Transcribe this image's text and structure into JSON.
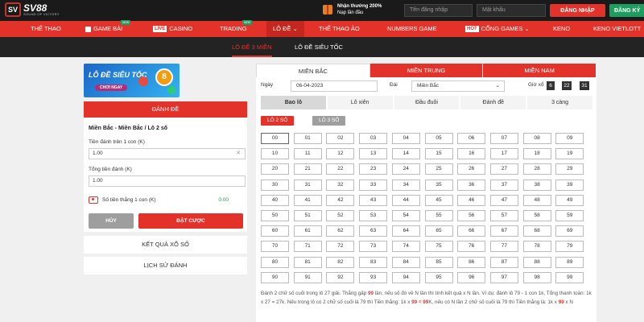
{
  "header": {
    "logo_mark": "SV",
    "logo_name": "SV88",
    "logo_sub": "SOUND OF VICTORY",
    "promo_title": "Nhận thưởng 200%",
    "promo_sub": "Nạp lần đầu",
    "username_placeholder": "Tên đăng nhập",
    "password_placeholder": "Mật khẩu",
    "login_label": "ĐĂNG NHẬP",
    "register_label": "ĐĂNG KÝ"
  },
  "nav": {
    "items": [
      {
        "label": "THỂ THAO"
      },
      {
        "label": "GAME BÀI",
        "badge": "NEW"
      },
      {
        "label": "CASINO",
        "tag": "LIVE"
      },
      {
        "label": "TRADING",
        "badge": "NEW"
      },
      {
        "label": "LÔ ĐỀ"
      },
      {
        "label": "THỂ THAO ẢO"
      },
      {
        "label": "NUMBERS GAME"
      },
      {
        "label": "CỔNG GAMES",
        "tag": "HOT"
      },
      {
        "label": "KENO"
      },
      {
        "label": "KENO VIETLOTT"
      }
    ]
  },
  "subnav": {
    "items": [
      {
        "label": "LÔ ĐỀ 3 MIỀN"
      },
      {
        "label": "LÔ ĐỀ SIÊU TỐC"
      }
    ]
  },
  "banner": {
    "title": "LÔ ĐỀ SIÊU TỐC",
    "button": "CHƠI NGAY",
    "ball_number": "8"
  },
  "bet_panel": {
    "header": "ĐÁNH ĐỀ",
    "selection": "Miền Bắc - Miền Bắc / Lô 2 số",
    "stake_label": "Tiền đánh trên 1 con (K)",
    "stake_value": "1.00",
    "total_label": "Tổng tiền đánh (K)",
    "total_value": "1.00",
    "win_label": "Số tiền thắng 1 con (K)",
    "win_value": "0.00",
    "cancel_label": "HỦY",
    "bet_label": "ĐẶT CƯỢC"
  },
  "side_links": {
    "results": "KẾT QUẢ XỔ SỐ",
    "history": "LỊCH SỬ ĐÁNH"
  },
  "region_tabs": [
    {
      "label": "MIỀN BẮC"
    },
    {
      "label": "MIỀN TRUNG"
    },
    {
      "label": "MIỀN NAM"
    }
  ],
  "filters": {
    "date_label": "Ngày",
    "date_value": "06-04-2023",
    "station_label": "Đài",
    "station_value": "Miền Bắc",
    "time_label": "Giờ xổ",
    "time_h": "6",
    "time_m": "22",
    "time_s": "31"
  },
  "type_tabs": [
    {
      "label": "Bao lô"
    },
    {
      "label": "Lô xiên"
    },
    {
      "label": "Đầu đuôi"
    },
    {
      "label": "Đánh đề"
    },
    {
      "label": "3 càng"
    }
  ],
  "sub_tabs": [
    {
      "label": "LÔ 2 SỐ"
    },
    {
      "label": "LÔ 3 SỐ"
    }
  ],
  "numbers": [
    "00",
    "01",
    "02",
    "03",
    "04",
    "05",
    "06",
    "07",
    "08",
    "09",
    "10",
    "11",
    "12",
    "13",
    "14",
    "15",
    "16",
    "17",
    "18",
    "19",
    "20",
    "21",
    "22",
    "23",
    "24",
    "25",
    "26",
    "27",
    "28",
    "29",
    "30",
    "31",
    "32",
    "33",
    "34",
    "35",
    "36",
    "37",
    "38",
    "39",
    "40",
    "41",
    "42",
    "43",
    "44",
    "45",
    "46",
    "47",
    "48",
    "49",
    "50",
    "51",
    "52",
    "53",
    "54",
    "55",
    "56",
    "57",
    "58",
    "59",
    "60",
    "61",
    "62",
    "63",
    "64",
    "65",
    "66",
    "67",
    "68",
    "69",
    "70",
    "71",
    "72",
    "73",
    "74",
    "75",
    "76",
    "77",
    "78",
    "79",
    "80",
    "81",
    "82",
    "83",
    "84",
    "85",
    "86",
    "87",
    "88",
    "89",
    "90",
    "91",
    "92",
    "93",
    "94",
    "95",
    "96",
    "97",
    "98",
    "99"
  ],
  "description": {
    "p1": "Đánh 2 chữ số cuối trong lô 27 giải. Thắng gấp ",
    "hl1": "99",
    "p2": " lần, nếu số đó về N lần thì tính kết quả x N lần. Ví dụ: đánh lô 79 - 1 con 1k, Tổng thanh toán: 1k x 27 = 27k. Nếu trong lô có 2 chữ số cuối là 79 thì Tiền thắng: 1k x ",
    "hl2": "99 = 99",
    "p3": "K, nếu có N lần 2 chữ số cuối là 79 thì Tiền thắng là: 1k x ",
    "hl3": "99",
    "p4": " x N"
  },
  "colors": {
    "brand_red": "#e3322a",
    "green": "#1e9e5e",
    "dark": "#1a1a1a"
  }
}
